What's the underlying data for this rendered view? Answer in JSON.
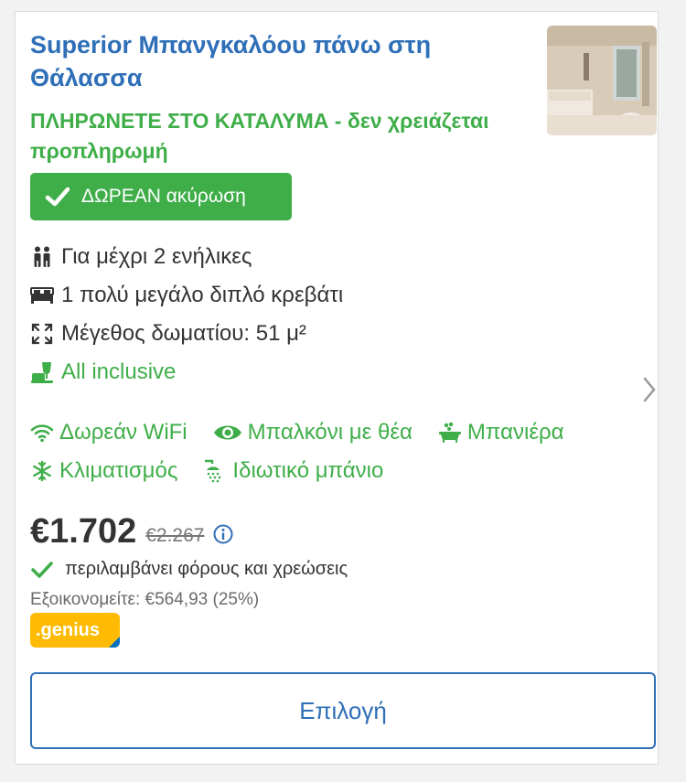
{
  "room": {
    "title": "Superior Μπανγκαλόου πάνω στη Θάλασσα",
    "payment_note": "ΠΛΗΡΩΝΕΤΕ ΣΤΟ ΚΑΤΑΛΥΜΑ - δεν χρειάζεται προπληρωμή",
    "cancellation_badge": "ΔΩΡΕΑΝ ακύρωση"
  },
  "features": [
    {
      "icon": "guests-icon",
      "text": "Για μέχρι 2 ενήλικες"
    },
    {
      "icon": "bed-icon",
      "text": "1 πολύ μεγάλο διπλό κρεβάτι"
    },
    {
      "icon": "room-size-icon",
      "text": "Μέγεθος δωματίου: 51 μ²"
    },
    {
      "icon": "all-inclusive-icon",
      "text": "All inclusive"
    }
  ],
  "amenities": [
    {
      "icon": "wifi-icon",
      "text": "Δωρεάν WiFi"
    },
    {
      "icon": "eye-icon",
      "text": "Μπαλκόνι με θέα"
    },
    {
      "icon": "bathtub-icon",
      "text": "Μπανιέρα"
    },
    {
      "icon": "snowflake-icon",
      "text": "Κλιματισμός"
    },
    {
      "icon": "shower-icon",
      "text": "Ιδιωτικό μπάνιο"
    }
  ],
  "pricing": {
    "price": "€1.702",
    "original_price": "€2.267",
    "taxes_note": "περιλαμβάνει φόρους και χρεώσεις",
    "savings": "Εξοικονομείτε: €564,93 (25%)"
  },
  "genius_label": ".genius",
  "select_button": "Επιλογή",
  "colors": {
    "title": "#2f6fb8",
    "green": "#3fae49",
    "genius_yellow": "#febb02",
    "genius_blue": "#0071c2"
  }
}
